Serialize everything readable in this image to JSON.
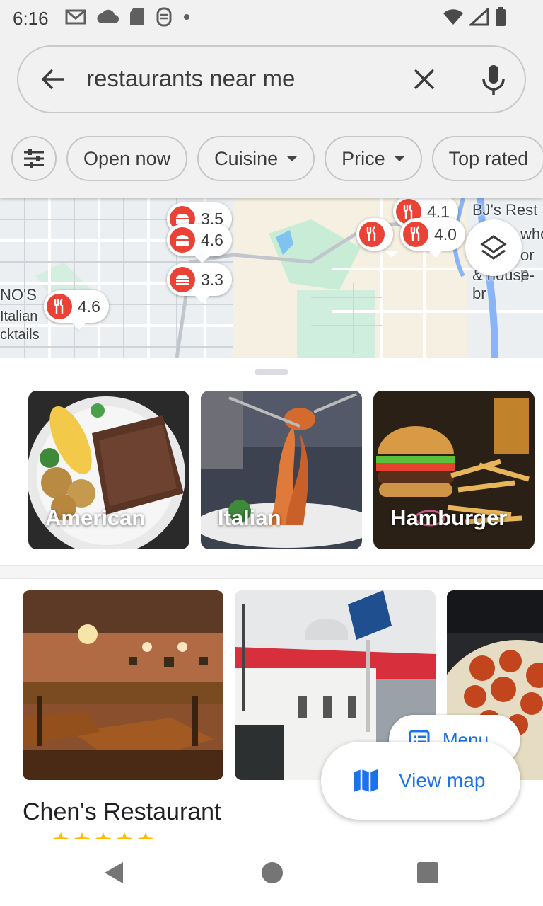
{
  "status_bar": {
    "time": "6:16",
    "left_icons": [
      "gmail-icon",
      "cloud-icon",
      "sd-card-icon",
      "sim-icon",
      "dot-icon"
    ],
    "right_icons": [
      "wifi-icon",
      "signal-icon",
      "battery-icon"
    ]
  },
  "search": {
    "query": "restaurants near me",
    "icons": [
      "back-arrow-icon",
      "close-icon",
      "mic-icon"
    ]
  },
  "filters": {
    "chips": [
      {
        "label": "Open now",
        "dropdown": false
      },
      {
        "label": "Cuisine",
        "dropdown": true
      },
      {
        "label": "Price",
        "dropdown": true
      },
      {
        "label": "Top rated",
        "dropdown": false
      }
    ]
  },
  "map": {
    "pins": [
      {
        "rating": "3.5",
        "icon": "burger-icon"
      },
      {
        "rating": "4.6",
        "icon": "burger-icon"
      },
      {
        "rating": "3.3",
        "icon": "burger-icon"
      },
      {
        "rating": "4.6",
        "icon": "fork-knife-icon"
      },
      {
        "rating": "4.1",
        "icon": "fork-knife-icon"
      },
      {
        "rating": "4.0",
        "icon": "fork-knife-icon"
      }
    ],
    "labels": {
      "label_1": "BJ's Rest",
      "label_2": "who",
      "label_3": "or p",
      "label_4": "& house-br",
      "label_5": "NO'S",
      "label_6": "Italian",
      "label_7": "cktails"
    }
  },
  "categories": [
    {
      "label": "American"
    },
    {
      "label": "Italian"
    },
    {
      "label": "Hamburger"
    }
  ],
  "place": {
    "name": "Chen's Restaurant",
    "menu_label": "Menu"
  },
  "view_map": {
    "label": "View map"
  },
  "colors": {
    "accent": "#1a73e8",
    "pin_red": "#ea4335",
    "top_background": "#f1f1f1"
  }
}
